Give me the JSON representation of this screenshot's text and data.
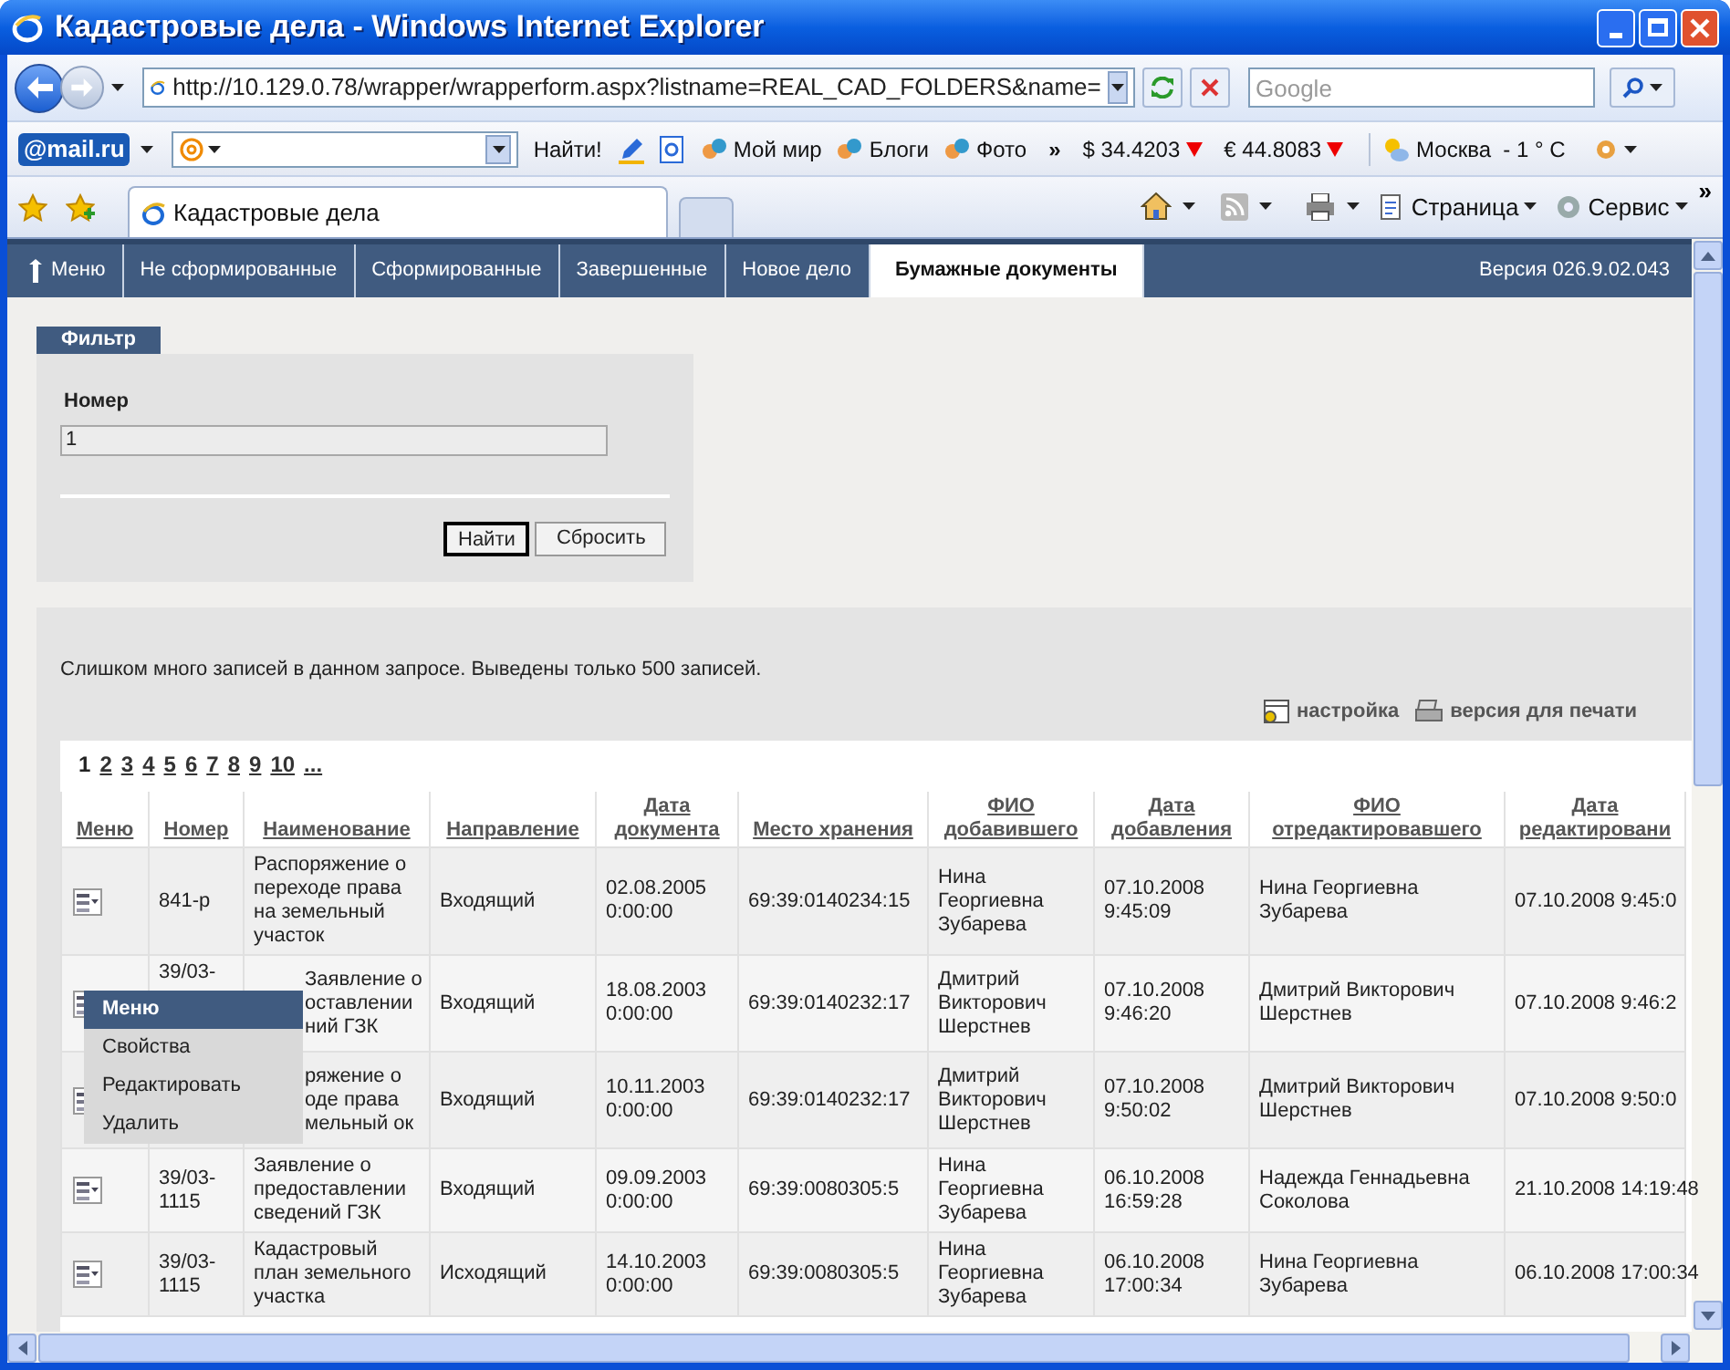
{
  "window": {
    "title": "Кадастровые дела - Windows Internet Explorer"
  },
  "address_bar": {
    "url": "http://10.129.0.78/wrapper/wrapperform.aspx?listname=REAL_CAD_FOLDERS&name="
  },
  "search_box": {
    "placeholder": "Google"
  },
  "mail_toolbar": {
    "logo": "@mail.ru",
    "find_button": "Найти!",
    "links": [
      "Мой мир",
      "Блоги",
      "Фото"
    ],
    "more": "»",
    "rates": [
      "$ 34.4203",
      "€ 44.8083"
    ],
    "weather": "Москва  - 1 ° C"
  },
  "tabs": [
    {
      "label": "Кадастровые дела",
      "selected": true
    }
  ],
  "command_bar": {
    "items": [
      "Страница",
      "Сервис"
    ],
    "more": "»"
  },
  "app_nav": {
    "items": [
      {
        "label": "Меню",
        "selected": false
      },
      {
        "label": "Не сформированные",
        "selected": false
      },
      {
        "label": "Сформированные",
        "selected": false
      },
      {
        "label": "Завершенные",
        "selected": false
      },
      {
        "label": "Новое дело",
        "selected": false
      },
      {
        "label": "Бумажные документы",
        "selected": true
      }
    ],
    "version": "Версия 026.9.02.043"
  },
  "filter": {
    "title": "Фильтр",
    "field_label": "Номер",
    "value": "1",
    "buttons": [
      "Найти",
      "Сбросить"
    ]
  },
  "results": {
    "message": "Слишком много записей в данном запросе. Выведены только 500 записей.",
    "links": [
      "настройка",
      "версия для печати"
    ],
    "pages": [
      {
        "label": "1",
        "selected": true
      },
      {
        "label": "2",
        "selected": false
      },
      {
        "label": "3",
        "selected": false
      },
      {
        "label": "4",
        "selected": false
      },
      {
        "label": "5",
        "selected": false
      },
      {
        "label": "6",
        "selected": false
      },
      {
        "label": "7",
        "selected": false
      },
      {
        "label": "8",
        "selected": false
      },
      {
        "label": "9",
        "selected": false
      },
      {
        "label": "10",
        "selected": false
      },
      {
        "label": "...",
        "selected": false
      }
    ],
    "columns": [
      "Меню",
      "Номер",
      "Наименование",
      "Направление",
      "Дата документа",
      "Место хранения",
      "ФИО добавившего",
      "Дата добавления",
      "ФИО отредактировавшего",
      "Дата редактировани"
    ],
    "rows": [
      {
        "under_menu": false,
        "number": "841-р",
        "name": "Распоряжение о переходе права на земельный участок",
        "direction": "Входящий",
        "doc_date": "02.08.2005 0:00:00",
        "location": "69:39:0140234:15",
        "added_by": "Нина Георгиевна Зубарева",
        "added_date": "07.10.2008 9:45:09",
        "edited_by": "Нина Георгиевна Зубарева",
        "edited_date": "07.10.2008 9:45:0"
      },
      {
        "under_menu": true,
        "number": "39/03-",
        "name": "Заявление о оставлении ний ГЗК",
        "direction": "Входящий",
        "doc_date": "18.08.2003 0:00:00",
        "location": "69:39:0140232:17",
        "added_by": "Дмитрий Викторович Шерстнев",
        "added_date": "07.10.2008 9:46:20",
        "edited_by": "Дмитрий Викторович Шерстнев",
        "edited_date": "07.10.2008 9:46:2"
      },
      {
        "under_menu": true,
        "name": "ряжение о оде права мельный ок",
        "direction": "Входящий",
        "doc_date": "10.11.2003 0:00:00",
        "location": "69:39:0140232:17",
        "added_by": "Дмитрий Викторович Шерстнев",
        "added_date": "07.10.2008 9:50:02",
        "edited_by": "Дмитрий Викторович Шерстнев",
        "edited_date": "07.10.2008 9:50:0"
      },
      {
        "under_menu": false,
        "number": "39/03-1115",
        "name": "Заявление о предоставлении сведений ГЗК",
        "direction": "Входящий",
        "doc_date": "09.09.2003 0:00:00",
        "location": "69:39:0080305:5",
        "added_by": "Нина Георгиевна Зубарева",
        "added_date": "06.10.2008 16:59:28",
        "edited_by": "Надежда Геннадьевна Соколова",
        "edited_date": "21.10.2008 14:19:48"
      },
      {
        "under_menu": false,
        "number": "39/03-1115",
        "name": "Кадастровый план земельного участка",
        "direction": "Исходящий",
        "doc_date": "14.10.2003 0:00:00",
        "location": "69:39:0080305:5",
        "added_by": "Нина Георгиевна Зубарева",
        "added_date": "06.10.2008 17:00:34",
        "edited_by": "Нина Георгиевна Зубарева",
        "edited_date": "06.10.2008 17:00:34"
      }
    ]
  },
  "context_menu": {
    "title": "Меню",
    "items": [
      "Свойства",
      "Редактировать",
      "Удалить"
    ]
  }
}
